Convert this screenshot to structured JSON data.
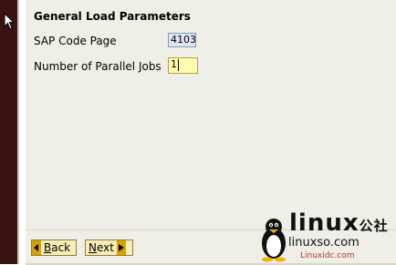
{
  "section": {
    "title": "General Load Parameters"
  },
  "fields": {
    "code_page": {
      "label": "SAP Code Page",
      "value": "4103"
    },
    "parallel_jobs": {
      "label": "Number of Parallel Jobs",
      "value": "1"
    }
  },
  "buttons": {
    "back": {
      "underline": "B",
      "rest": "ack"
    },
    "next": {
      "underline": "N",
      "rest": "ext"
    }
  },
  "watermark": {
    "brand": "linux",
    "brand_cjk": "公社",
    "domain": "linuxso.com",
    "domain2": "Linuxidc.com"
  },
  "icons": {
    "back_arrow": "arrow-left-icon",
    "next_arrow": "arrow-right-icon",
    "cursor": "mouse-pointer-icon",
    "tux": "tux-penguin-icon"
  },
  "colors": {
    "panel_bg": "#efefe7",
    "left_bar": "#3a1212",
    "input_readonly": "#dfe4f1",
    "input_active": "#fffbb0",
    "button_bg": "#f7eeb7",
    "button_arrow": "#d9a000"
  }
}
